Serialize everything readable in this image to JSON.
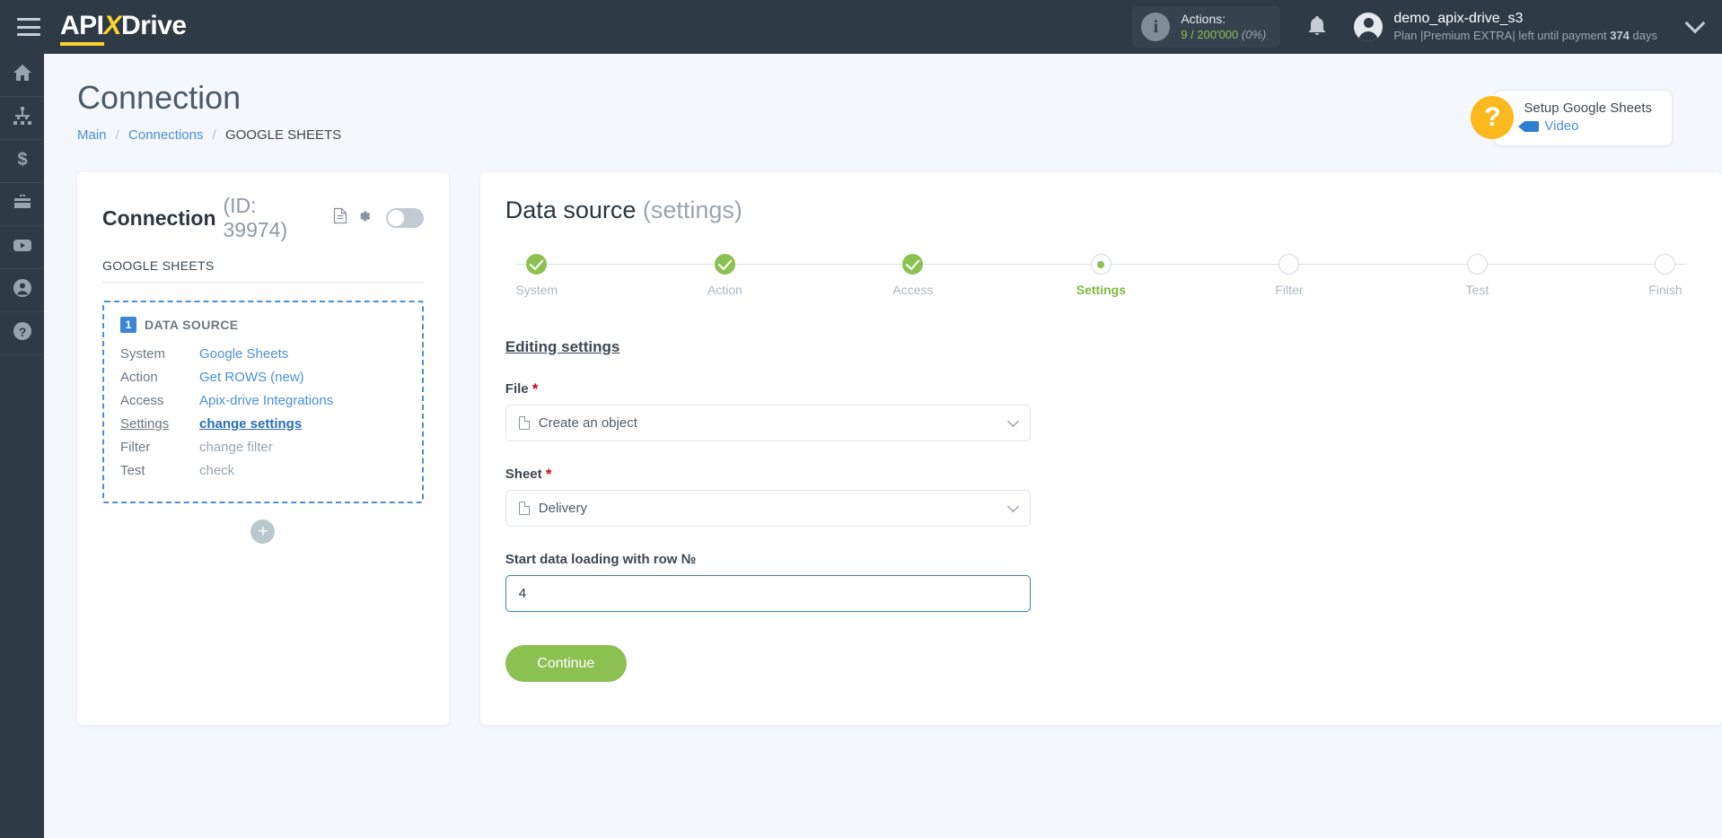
{
  "brand": {
    "api": "API",
    "x": "X",
    "drive": "Drive",
    "accent": "#ffd32a",
    "bar_bg": "#2e3b47"
  },
  "topbar": {
    "menu_icon": "hamburger-icon",
    "actions": {
      "label": "Actions:",
      "count": "9 / 200'000",
      "percent": "(0%)",
      "count_color": "#8cc152"
    },
    "notifications_icon": "bell-icon",
    "user": {
      "name": "demo_apix-drive_s3",
      "plan_prefix": "Plan |",
      "plan_name": "Premium EXTRA",
      "plan_suffix": "| left until payment ",
      "days": "374",
      "days_suffix": " days"
    },
    "chevron_icon": "chevron-down-icon"
  },
  "rail": {
    "items": [
      {
        "name": "home",
        "icon": "home-icon"
      },
      {
        "name": "connections",
        "icon": "sitemap-icon"
      },
      {
        "name": "billing",
        "icon": "dollar-icon"
      },
      {
        "name": "business",
        "icon": "briefcase-icon"
      },
      {
        "name": "video",
        "icon": "youtube-icon"
      },
      {
        "name": "account",
        "icon": "user-circle-icon"
      },
      {
        "name": "help",
        "icon": "question-circle-icon"
      }
    ]
  },
  "page": {
    "title": "Connection",
    "breadcrumb": {
      "main": "Main",
      "connections": "Connections",
      "current": "GOOGLE SHEETS",
      "separator": "/"
    }
  },
  "help_badge": {
    "mark": "?",
    "title": "Setup Google Sheets",
    "video_label": "Video",
    "video_icon": "video-camera-icon",
    "badge_color": "#fbb91e"
  },
  "connection_card": {
    "title": "Connection",
    "id_label": "(ID: 39974)",
    "doc_icon": "document-icon",
    "gear_icon": "gear-icon",
    "toggle_state": "off",
    "subtitle": "GOOGLE SHEETS",
    "data_source": {
      "number": "1",
      "heading": "DATA SOURCE",
      "rows": [
        {
          "key": "System",
          "value": "Google Sheets",
          "style": "link"
        },
        {
          "key": "Action",
          "value": "Get ROWS (new)",
          "style": "link"
        },
        {
          "key": "Access",
          "value": "Apix-drive Integrations",
          "style": "link"
        },
        {
          "key": "Settings",
          "value": "change settings",
          "style": "strong"
        },
        {
          "key": "Filter",
          "value": "change filter",
          "style": "plain"
        },
        {
          "key": "Test",
          "value": "check",
          "style": "plain"
        }
      ]
    },
    "add_button": "+"
  },
  "main": {
    "title": "Data source",
    "title_dim": "(settings)",
    "steps": [
      {
        "label": "System",
        "state": "done"
      },
      {
        "label": "Action",
        "state": "done"
      },
      {
        "label": "Access",
        "state": "done"
      },
      {
        "label": "Settings",
        "state": "active"
      },
      {
        "label": "Filter",
        "state": "pending"
      },
      {
        "label": "Test",
        "state": "pending"
      },
      {
        "label": "Finish",
        "state": "pending"
      }
    ],
    "form": {
      "heading": "Editing settings",
      "file": {
        "label": "File",
        "required": "*",
        "value": "Create an object",
        "icon": "file-icon",
        "chevron": "chevron-down-icon"
      },
      "sheet": {
        "label": "Sheet",
        "required": "*",
        "value": "Delivery",
        "icon": "file-icon",
        "chevron": "chevron-down-icon"
      },
      "start_row": {
        "label": "Start data loading with row №",
        "value": "4",
        "placeholder": ""
      },
      "submit": "Continue"
    }
  }
}
